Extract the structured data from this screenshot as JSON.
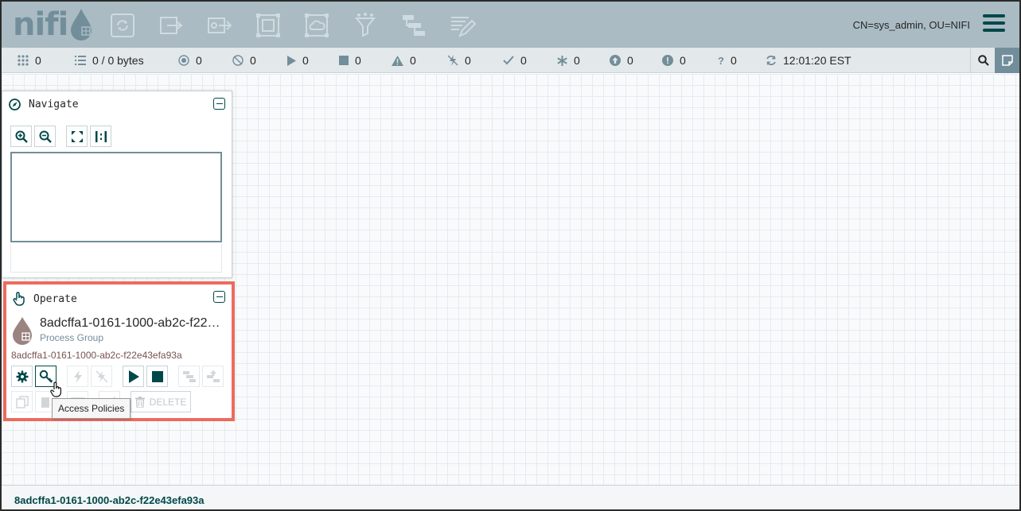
{
  "header": {
    "logo_text": "nifi",
    "toolbar": [
      "processor-icon",
      "input-port-icon",
      "output-port-icon",
      "process-group-icon",
      "remote-process-group-icon",
      "funnel-icon",
      "template-icon",
      "label-icon"
    ],
    "user": "CN=sys_admin, OU=NIFI"
  },
  "status": {
    "active_threads": "0",
    "queued": "0 / 0 bytes",
    "transmitting": "0",
    "not_transmitting": "0",
    "running": "0",
    "stopped": "0",
    "invalid": "0",
    "disabled": "0",
    "up_to_date": "0",
    "locally_modified": "0",
    "stale": "0",
    "locally_modified_stale": "0",
    "sync_failure": "0",
    "refreshed": "12:01:20 EST"
  },
  "navigate": {
    "title": "Navigate"
  },
  "operate": {
    "title": "Operate",
    "name": "8adcffa1-0161-1000-ab2c-f22e43efa93a",
    "type": "Process Group",
    "id": "8adcffa1-0161-1000-ab2c-f22e43efa93a",
    "delete_label": "DELETE",
    "tooltip": "Access Policies"
  },
  "footer": {
    "breadcrumb": "8adcffa1-0161-1000-ab2c-f22e43efa93a"
  },
  "colors": {
    "header_bg": "#aabbc3",
    "accent": "#004849",
    "highlight_border": "#ec6b5f",
    "muted": "#728e9b"
  }
}
